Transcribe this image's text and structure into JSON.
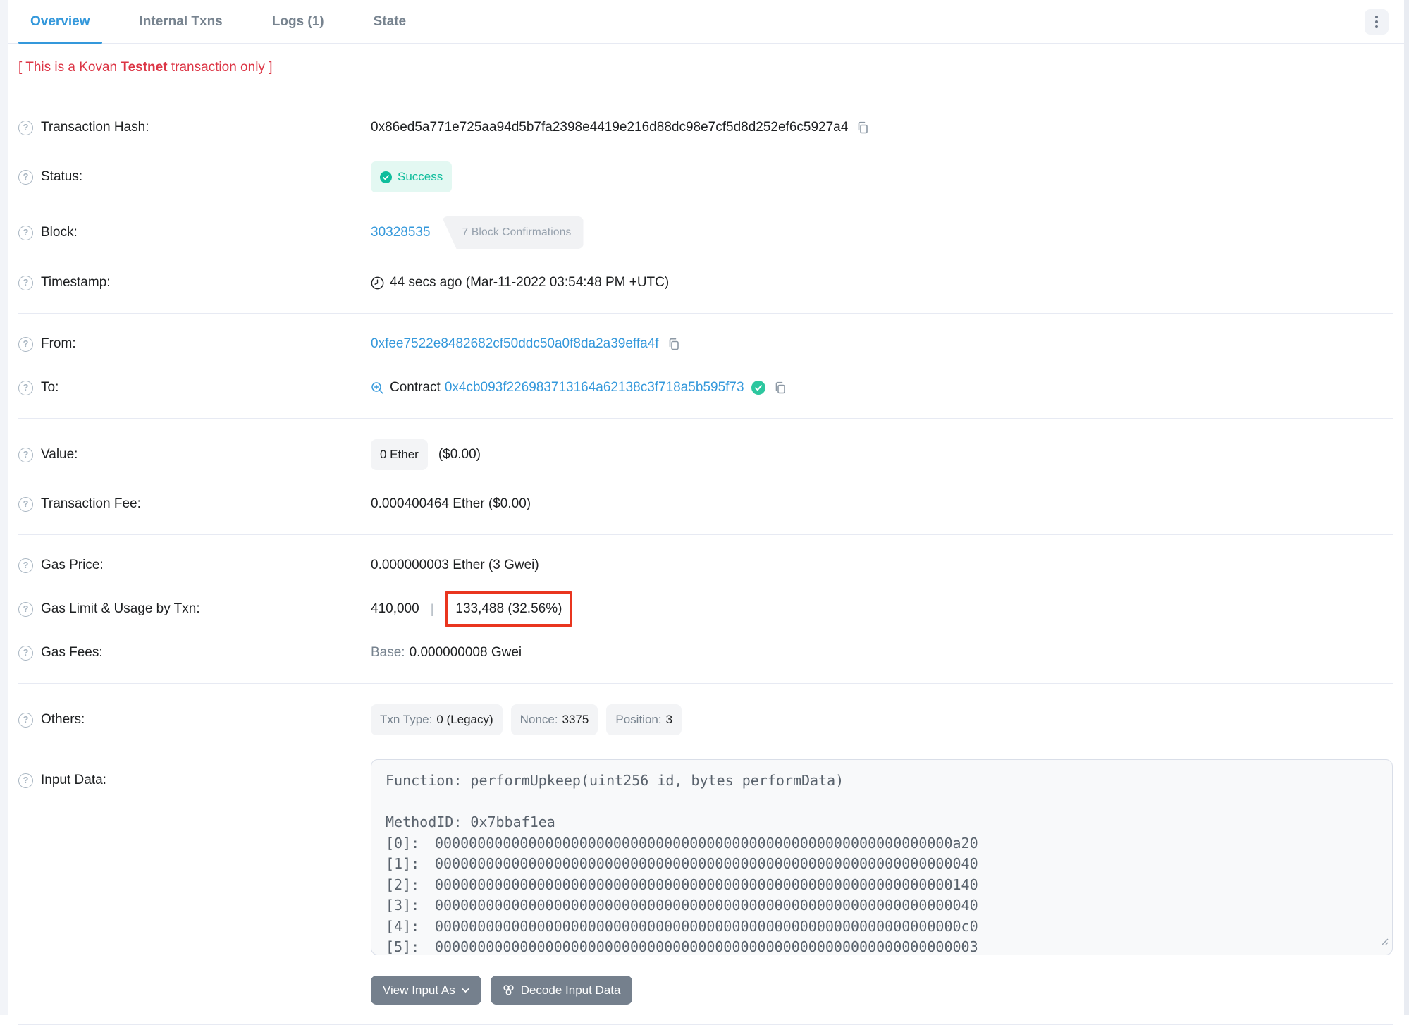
{
  "tabs": {
    "items": [
      {
        "label": "Overview",
        "active": true
      },
      {
        "label": "Internal Txns",
        "active": false
      },
      {
        "label": "Logs (1)",
        "active": false
      },
      {
        "label": "State",
        "active": false
      }
    ]
  },
  "warning": {
    "prefix": "[ This is a Kovan ",
    "bold": "Testnet",
    "suffix": " transaction only ]"
  },
  "rows": {
    "transaction_hash": {
      "label": "Transaction Hash:",
      "value": "0x86ed5a771e725aa94d5b7fa2398e4419e216d88dc98e7cf5d8d252ef6c5927a4"
    },
    "status": {
      "label": "Status:",
      "value": "Success"
    },
    "block": {
      "label": "Block:",
      "value": "30328535",
      "confirmations": "7 Block Confirmations"
    },
    "timestamp": {
      "label": "Timestamp:",
      "value": "44 secs ago (Mar-11-2022 03:54:48 PM +UTC)"
    },
    "from": {
      "label": "From:",
      "value": "0xfee7522e8482682cf50ddc50a0f8da2a39effa4f"
    },
    "to": {
      "label": "To:",
      "prefix": "Contract",
      "value": "0x4cb093f226983713164a62138c3f718a5b595f73"
    },
    "value": {
      "label": "Value:",
      "badge": "0 Ether",
      "usd": "($0.00)"
    },
    "transaction_fee": {
      "label": "Transaction Fee:",
      "value": "0.000400464 Ether ($0.00)"
    },
    "gas_price": {
      "label": "Gas Price:",
      "value": "0.000000003 Ether (3 Gwei)"
    },
    "gas_limit": {
      "label": "Gas Limit & Usage by Txn:",
      "limit": "410,000",
      "separator": "|",
      "usage": "133,488 (32.56%)"
    },
    "gas_fees": {
      "label": "Gas Fees:",
      "base_label": "Base:",
      "base_value": "0.000000008 Gwei"
    },
    "others": {
      "label": "Others:",
      "badges": [
        {
          "name": "Txn Type:",
          "value": "0 (Legacy)"
        },
        {
          "name": "Nonce:",
          "value": "3375"
        },
        {
          "name": "Position:",
          "value": "3"
        }
      ]
    },
    "input_data": {
      "label": "Input Data:",
      "function": "Function: performUpkeep(uint256 id, bytes performData)",
      "method_id": "MethodID: 0x7bbaf1ea",
      "params": [
        {
          "index": "[0]:",
          "value": "0000000000000000000000000000000000000000000000000000000000000a20"
        },
        {
          "index": "[1]:",
          "value": "0000000000000000000000000000000000000000000000000000000000000040"
        },
        {
          "index": "[2]:",
          "value": "0000000000000000000000000000000000000000000000000000000000000140"
        },
        {
          "index": "[3]:",
          "value": "0000000000000000000000000000000000000000000000000000000000000040"
        },
        {
          "index": "[4]:",
          "value": "00000000000000000000000000000000000000000000000000000000000000c0"
        },
        {
          "index": "[5]:",
          "value": "0000000000000000000000000000000000000000000000000000000000000003"
        }
      ]
    }
  },
  "buttons": {
    "view_input_as": "View Input As",
    "decode": "Decode Input Data"
  },
  "colors": {
    "link_blue": "#3498db",
    "success_teal": "#0fbd9c",
    "danger_red": "#dc3545",
    "annotation_red": "#e9351f",
    "muted_gray": "#77838f",
    "divider": "#e7eaf3",
    "button_gray": "#75808d"
  },
  "help_glyph": "?"
}
